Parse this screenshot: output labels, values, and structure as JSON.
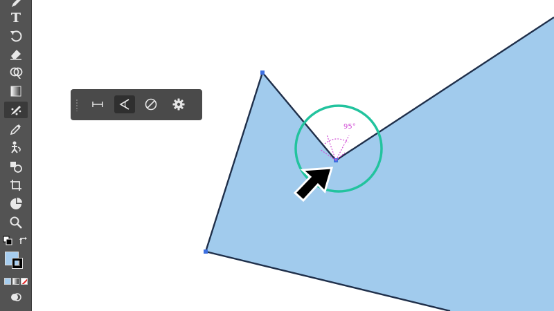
{
  "canvas": {
    "angle_readout": "95°",
    "colors": {
      "shape_fill": "#a1cbed",
      "shape_stroke": "#1f2f4a",
      "anchor": "#3d6fe0",
      "widget_ring": "#22c39e",
      "angle_guide": "#d24fd6",
      "cursor": "#000000"
    }
  },
  "toolbar": {
    "tools": [
      {
        "name": "pencil-tool",
        "icon": "pencil-icon"
      },
      {
        "name": "type-tool",
        "icon": "type-icon",
        "glyph": "T"
      },
      {
        "name": "rotate-tool",
        "icon": "rotate-icon"
      },
      {
        "name": "eraser-tool",
        "icon": "eraser-icon"
      },
      {
        "name": "shape-builder-tool",
        "icon": "shape-builder-icon"
      },
      {
        "name": "gradient-tool",
        "icon": "gradient-icon"
      },
      {
        "name": "curvature-tool",
        "icon": "curvature-icon",
        "active": true
      },
      {
        "name": "eyedropper-tool",
        "icon": "eyedropper-icon"
      },
      {
        "name": "puppet-warp-tool",
        "icon": "puppet-warp-icon"
      },
      {
        "name": "live-paint-tool",
        "icon": "live-paint-icon"
      },
      {
        "name": "artboard-tool",
        "icon": "artboard-icon"
      },
      {
        "name": "chart-tool",
        "icon": "pie-chart-icon"
      },
      {
        "name": "zoom-tool",
        "icon": "magnifier-icon"
      }
    ],
    "fill_color": "#a6cdef",
    "stroke_color": "#000000"
  },
  "tool_options": {
    "buttons": [
      {
        "name": "measure-button",
        "icon": "measure-icon"
      },
      {
        "name": "angle-button",
        "icon": "angle-icon",
        "active": true
      },
      {
        "name": "none-button",
        "icon": "none-icon"
      },
      {
        "name": "settings-button",
        "icon": "gear-icon"
      }
    ]
  }
}
